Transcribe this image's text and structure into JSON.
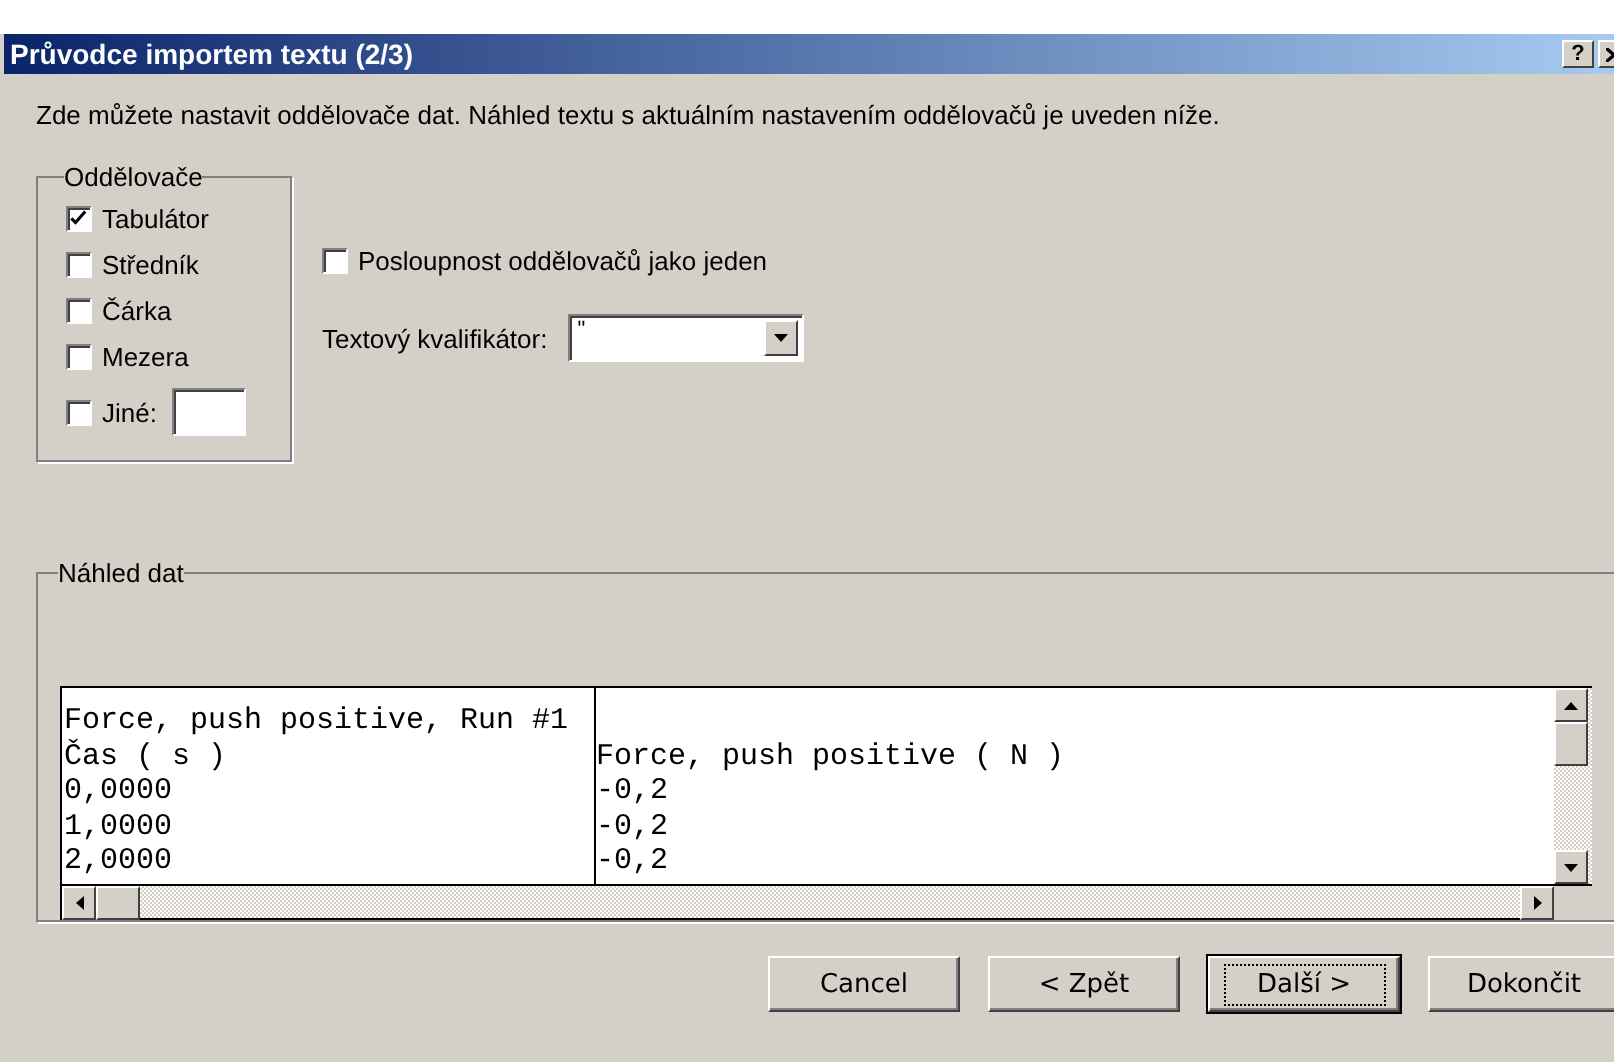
{
  "window": {
    "title": "Průvodce importem textu (2/3)",
    "title_buttons": [
      "?"
    ]
  },
  "description": "Zde můžete nastavit oddělovače dat. Náhled textu s aktuálním nastavením oddělovačů je uveden níže.",
  "delimiters": {
    "legend": "Oddělovače",
    "items": [
      {
        "label": "Tabulátor",
        "checked": true
      },
      {
        "label": "Středník",
        "checked": false
      },
      {
        "label": "Čárka",
        "checked": false
      },
      {
        "label": "Mezera",
        "checked": false
      },
      {
        "label": "Jiné:",
        "checked": false,
        "kind": "other"
      }
    ]
  },
  "treat_consecutive": {
    "label": "Posloupnost oddělovačů jako jeden",
    "checked": false
  },
  "text_qualifier": {
    "label": "Textový kvalifikátor:",
    "value": "\""
  },
  "preview": {
    "legend": "Náhled dat",
    "rows": [
      {
        "column_1": "Force, push positive, Run #1"
      },
      {
        "column_1": "Čas ( s )",
        "column_2": "Force, push positive ( N )"
      },
      {
        "column_1": "0,0000",
        "column_2": "-0,2"
      },
      {
        "column_1": "1,0000",
        "column_2": "-0,2"
      },
      {
        "column_1": "2,0000",
        "column_2": "-0,2"
      }
    ]
  },
  "buttons": [
    {
      "label": "Cancel",
      "default": false
    },
    {
      "label": "< Zpět",
      "default": false
    },
    {
      "label": "Další >",
      "default": true
    },
    {
      "label": "Dokončit",
      "default": false
    }
  ]
}
